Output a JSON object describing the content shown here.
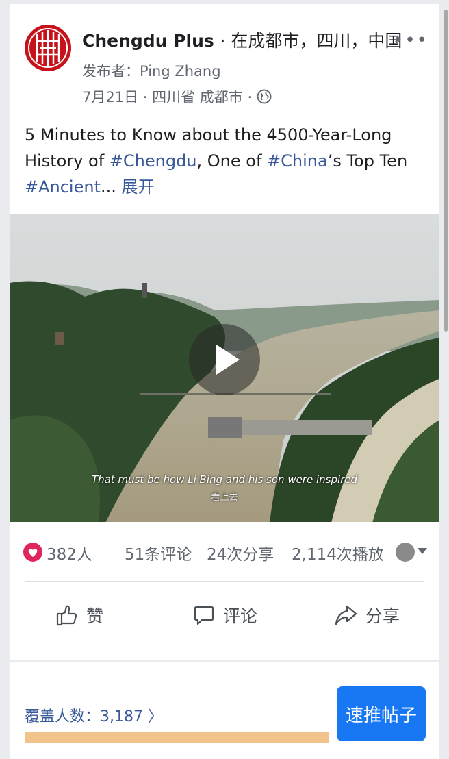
{
  "post": {
    "page_name": "Chengdu Plus",
    "location": "· 在成都市，四川，中国",
    "publisher": "发布者：Ping Zhang",
    "meta": "7月21日 · 四川省 成都市 ·",
    "text_1": "5 Minutes to Know about the 4500-Year-Long History of ",
    "tag_1": "#Chengdu",
    "text_2": ", One of ",
    "tag_2": "#China",
    "text_3": "’s Top Ten ",
    "tag_3": "#Ancient",
    "text_4": "... ",
    "expand": "展开",
    "more_label": "•••"
  },
  "video": {
    "subtitle": "That must be how Li Bing and his son were inspired",
    "subtitle_zh": "看上去"
  },
  "stats": {
    "likes": "382人",
    "comments": "51条评论",
    "shares": "24次分享",
    "views": "2,114次播放"
  },
  "actions": {
    "like": "赞",
    "comment": "评论",
    "share": "分享"
  },
  "footer": {
    "reach": "覆盖人数：3,187 〉",
    "boost": "速推帖子"
  },
  "colors": {
    "accent": "#385898",
    "brand_red": "#c6131b",
    "boost_blue": "#1877f2",
    "reach_bar": "#f2c38a"
  }
}
